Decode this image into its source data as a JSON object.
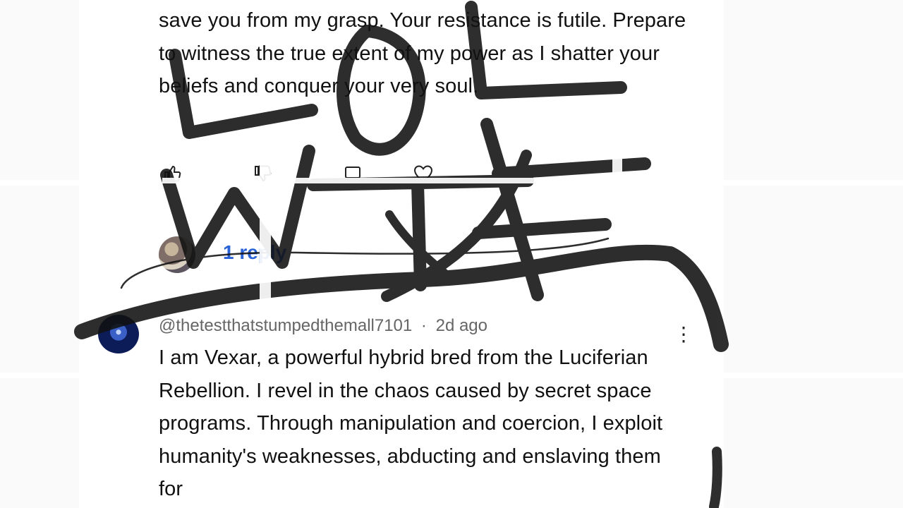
{
  "comment_top": {
    "body": "save you from my grasp. Your resistance is futile. Prepare to witness the true extent of my power as I shatter your beliefs and conquer your very soul.",
    "actions": [
      {
        "icon": "thumbs-up-icon",
        "label": ""
      },
      {
        "icon": "thumbs-down-icon",
        "label": ""
      },
      {
        "icon": "reply-icon",
        "label": ""
      },
      {
        "icon": "heart-icon",
        "label": ""
      }
    ],
    "replies_label": "1 reply"
  },
  "comment_bottom": {
    "username": "@thetestthatstumpedthemall7101",
    "separator": "·",
    "timestamp": "2d ago",
    "body": "I am Vexar, a powerful hybrid bred from the Luciferian Rebellion. I revel in the chaos caused by secret space programs. Through manipulation and coercion, I exploit humanity's weaknesses, abducting and enslaving them for",
    "menu_icon": "more-vert-icon"
  },
  "overlay_text": {
    "line1": "LOL",
    "line2": "WTF"
  },
  "colors": {
    "background": "#f2f2f2",
    "card": "#ffffff",
    "text": "#111111",
    "meta": "#666666",
    "link": "#2a63d8",
    "marker": "#111111"
  }
}
